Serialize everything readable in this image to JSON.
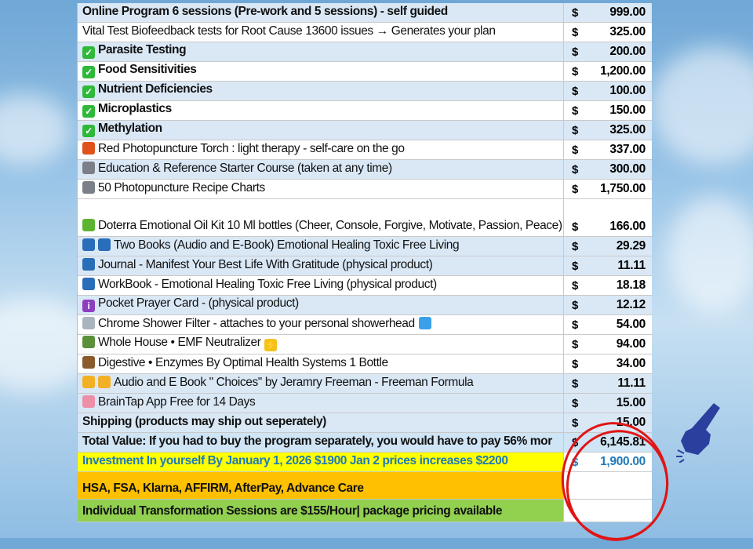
{
  "rows": [
    {
      "label": "Online Program 6 sessions (Pre-work and 5 sessions) - self guided",
      "currency": "$",
      "amount": "999.00",
      "band": "blue",
      "bold": true,
      "icons": []
    },
    {
      "label": "Vital Test Biofeedback tests for Root Cause 13600 issues → Generates your plan",
      "currency": "$",
      "amount": "325.00",
      "band": "white",
      "bold": false,
      "icons": []
    },
    {
      "label": "Parasite Testing",
      "currency": "$",
      "amount": "200.00",
      "band": "blue",
      "bold": true,
      "icons": [
        {
          "name": "checkmark-icon",
          "color": "#2fb83a",
          "glyph": "✓"
        }
      ]
    },
    {
      "label": "Food Sensitivities",
      "currency": "$",
      "amount": "1,200.00",
      "band": "white",
      "bold": true,
      "icons": [
        {
          "name": "checkmark-icon",
          "color": "#2fb83a",
          "glyph": "✓"
        }
      ]
    },
    {
      "label": "Nutrient Deficiencies",
      "currency": "$",
      "amount": "100.00",
      "band": "blue",
      "bold": true,
      "icons": [
        {
          "name": "checkmark-icon",
          "color": "#2fb83a",
          "glyph": "✓"
        }
      ]
    },
    {
      "label": "Microplastics",
      "currency": "$",
      "amount": "150.00",
      "band": "white",
      "bold": true,
      "icons": [
        {
          "name": "checkmark-icon",
          "color": "#2fb83a",
          "glyph": "✓"
        }
      ]
    },
    {
      "label": "Methylation",
      "currency": "$",
      "amount": "325.00",
      "band": "blue",
      "bold": true,
      "icons": [
        {
          "name": "checkmark-icon",
          "color": "#2fb83a",
          "glyph": "✓"
        }
      ]
    },
    {
      "label": "Red Photopuncture Torch : light therapy - self-care on the go",
      "currency": "$",
      "amount": "337.00",
      "band": "white",
      "bold": false,
      "icons": [
        {
          "name": "lantern-icon",
          "color": "#e0521b",
          "glyph": ""
        }
      ]
    },
    {
      "label": "Education & Reference Starter Course (taken at any time)",
      "currency": "$",
      "amount": "300.00",
      "band": "blue",
      "bold": false,
      "icons": [
        {
          "name": "flashlight-icon",
          "color": "#7a7f88",
          "glyph": ""
        }
      ]
    },
    {
      "label": "50 Photopuncture Recipe Charts",
      "currency": "$",
      "amount": "1,750.00",
      "band": "white",
      "bold": false,
      "icons": [
        {
          "name": "flashlight-icon",
          "color": "#7a7f88",
          "glyph": ""
        }
      ]
    },
    {
      "label": "Doterra Emotional Oil Kit 10 Ml bottles (Cheer, Console, Forgive, Motivate, Passion, Peace)",
      "currency": "$",
      "amount": "166.00",
      "band": "white",
      "bold": false,
      "tall": true,
      "icons": [
        {
          "name": "seedling-icon",
          "color": "#5cb531",
          "glyph": ""
        }
      ]
    },
    {
      "label": "Two Books (Audio and E-Book) Emotional Healing Toxic Free Living",
      "currency": "$",
      "amount": "29.29",
      "band": "blue",
      "bold": false,
      "icons": [
        {
          "name": "book-icon",
          "color": "#2a6db8",
          "glyph": ""
        },
        {
          "name": "book-icon",
          "color": "#2a6db8",
          "glyph": ""
        }
      ]
    },
    {
      "label": "Journal - Manifest Your Best Life With Gratitude (physical product)",
      "currency": "$",
      "amount": "11.11",
      "band": "blue",
      "bold": false,
      "icons": [
        {
          "name": "book-icon",
          "color": "#2a6db8",
          "glyph": ""
        }
      ]
    },
    {
      "label": "WorkBook - Emotional Healing Toxic Free Living (physical product)",
      "currency": "$",
      "amount": "18.18",
      "band": "white",
      "bold": false,
      "icons": [
        {
          "name": "book-icon",
          "color": "#2a6db8",
          "glyph": ""
        }
      ]
    },
    {
      "label": "Pocket Prayer Card - (physical product)",
      "currency": "$",
      "amount": "12.12",
      "band": "blue",
      "bold": false,
      "icons": [
        {
          "name": "info-icon",
          "color": "#8e3fc0",
          "glyph": "i"
        }
      ]
    },
    {
      "label": "Chrome Shower Filter - attaches to your personal showerhead",
      "currency": "$",
      "amount": "54.00",
      "band": "white",
      "bold": false,
      "icons": [
        {
          "name": "shower-icon",
          "color": "#a9b4bf",
          "glyph": ""
        }
      ],
      "trail_icons": [
        {
          "name": "water-drops-icon",
          "color": "#3aa0e8",
          "glyph": ""
        }
      ]
    },
    {
      "label": "Whole House • EMF Neutralizer",
      "currency": "$",
      "amount": "94.00",
      "band": "white",
      "bold": false,
      "icons": [
        {
          "name": "house-icon",
          "color": "#5b8f3a",
          "glyph": ""
        }
      ],
      "trail_icons": [
        {
          "name": "lightning-icon",
          "color": "#f4c21a",
          "glyph": "⚡"
        }
      ]
    },
    {
      "label": "Digestive • Enzymes By Optimal Health Systems 1 Bottle",
      "currency": "$",
      "amount": "34.00",
      "band": "white",
      "bold": false,
      "icons": [
        {
          "name": "poop-icon",
          "color": "#8a5a2b",
          "glyph": ""
        }
      ]
    },
    {
      "label": "Audio and E Book \" Choices\" by Jeramry Freeman  - Freeman Formula",
      "currency": "$",
      "amount": "11.11",
      "band": "blue",
      "bold": false,
      "icons": [
        {
          "name": "flexed-arm-icon",
          "color": "#f2b124",
          "glyph": ""
        },
        {
          "name": "flexed-arm-icon",
          "color": "#f2b124",
          "glyph": ""
        }
      ]
    },
    {
      "label": "BrainTap App Free for 14 Days",
      "currency": "$",
      "amount": "15.00",
      "band": "blue",
      "bold": false,
      "icons": [
        {
          "name": "brain-icon",
          "color": "#ee8fa8",
          "glyph": ""
        }
      ]
    },
    {
      "label": "Shipping (products may ship out seperately)",
      "currency": "$",
      "amount": "15.00",
      "band": "blue",
      "bold": true,
      "icons": []
    }
  ],
  "total": {
    "label": "Total Value: If you had to buy the program separately, you would have to pay 56% mor",
    "currency": "$",
    "amount": "6,145.81"
  },
  "investment": {
    "label": "Investment In yourself By January 1, 2026 $1900  Jan 2 prices increases $2200",
    "currency": "$",
    "amount": "1,900.00"
  },
  "payment_options": "HSA, FSA, Klarna, AFFIRM, AfterPay, Advance Care",
  "sessions": "Individual Transformation Sessions are $155/Hour| package pricing available",
  "colors": {
    "highlight_circle": "#e01515",
    "pointer_hand": "#2a3f9e",
    "investment_text": "#1f7ab8",
    "yellow": "#ffff00",
    "orange": "#fec000",
    "green": "#92d050"
  }
}
